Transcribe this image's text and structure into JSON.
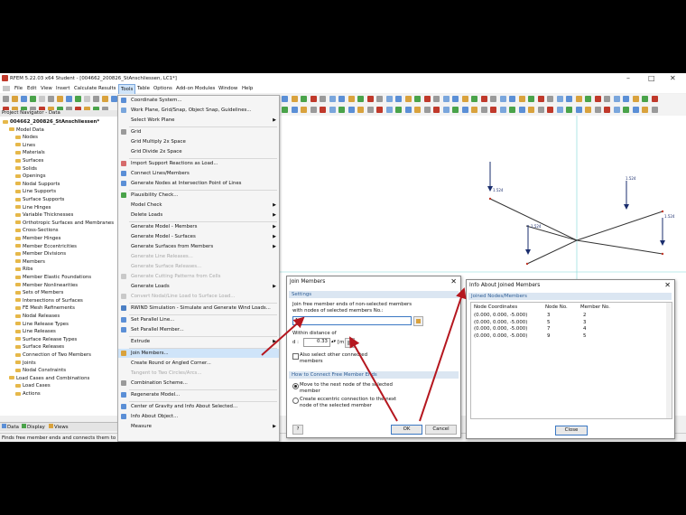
{
  "window": {
    "title": "RFEM 5.22.03 x64 Student - [004662_200826_StAnschliessen, LC1*]"
  },
  "menubar": [
    "File",
    "Edit",
    "View",
    "Insert",
    "Calculate",
    "Results",
    "Tools",
    "Table",
    "Options",
    "Add-on Modules",
    "Window",
    "Help"
  ],
  "navigator": {
    "title": "Project Navigator - Data",
    "items": [
      {
        "label": "004662_200826_StAnschliessen*",
        "indent": 0
      },
      {
        "label": "Model Data",
        "indent": 1
      },
      {
        "label": "Nodes",
        "indent": 2
      },
      {
        "label": "Lines",
        "indent": 2
      },
      {
        "label": "Materials",
        "indent": 2
      },
      {
        "label": "Surfaces",
        "indent": 2
      },
      {
        "label": "Solids",
        "indent": 2
      },
      {
        "label": "Openings",
        "indent": 2
      },
      {
        "label": "Nodal Supports",
        "indent": 2
      },
      {
        "label": "Line Supports",
        "indent": 2
      },
      {
        "label": "Surface Supports",
        "indent": 2
      },
      {
        "label": "Line Hinges",
        "indent": 2
      },
      {
        "label": "Variable Thicknesses",
        "indent": 2
      },
      {
        "label": "Orthotropic Surfaces and Membranes",
        "indent": 2
      },
      {
        "label": "Cross-Sections",
        "indent": 2
      },
      {
        "label": "Member Hinges",
        "indent": 2
      },
      {
        "label": "Member Eccentricities",
        "indent": 2
      },
      {
        "label": "Member Divisions",
        "indent": 2
      },
      {
        "label": "Members",
        "indent": 2
      },
      {
        "label": "Ribs",
        "indent": 2
      },
      {
        "label": "Member Elastic Foundations",
        "indent": 2
      },
      {
        "label": "Member Nonlinearities",
        "indent": 2
      },
      {
        "label": "Sets of Members",
        "indent": 2
      },
      {
        "label": "Intersections of Surfaces",
        "indent": 2
      },
      {
        "label": "FE Mesh Refinements",
        "indent": 2
      },
      {
        "label": "Nodal Releases",
        "indent": 2
      },
      {
        "label": "Line Release Types",
        "indent": 2
      },
      {
        "label": "Line Releases",
        "indent": 2
      },
      {
        "label": "Surface Release Types",
        "indent": 2
      },
      {
        "label": "Surface Releases",
        "indent": 2
      },
      {
        "label": "Connection of Two Members",
        "indent": 2
      },
      {
        "label": "Joints",
        "indent": 2
      },
      {
        "label": "Nodal Constraints",
        "indent": 2
      },
      {
        "label": "Load Cases and Combinations",
        "indent": 1
      },
      {
        "label": "Load Cases",
        "indent": 2
      },
      {
        "label": "Actions",
        "indent": 2
      }
    ],
    "tabs": [
      "Data",
      "Display",
      "Views"
    ]
  },
  "tools_menu": [
    {
      "label": "Coordinate System...",
      "disabled": false,
      "sub": false,
      "icon": "#5b8fd6",
      "sep": false
    },
    {
      "label": "Work Plane, Grid/Snap, Object Snap, Guidelines...",
      "disabled": false,
      "sub": false,
      "icon": "#7aa6dc",
      "sep": false
    },
    {
      "label": "Select Work Plane",
      "disabled": false,
      "sub": true,
      "icon": "",
      "sep": false
    },
    {
      "label": "Grid",
      "disabled": false,
      "sub": false,
      "icon": "#9a9a9a",
      "sep": true
    },
    {
      "label": "Grid Multiply 2x Space",
      "disabled": false,
      "sub": false,
      "icon": "",
      "sep": false
    },
    {
      "label": "Grid Divide 2x Space",
      "disabled": false,
      "sub": false,
      "icon": "",
      "sep": false
    },
    {
      "label": "Import Support Reactions as Load...",
      "disabled": false,
      "sub": false,
      "icon": "#d66b6b",
      "sep": true
    },
    {
      "label": "Connect Lines/Members",
      "disabled": false,
      "sub": false,
      "icon": "#5b8fd6",
      "sep": false
    },
    {
      "label": "Generate Nodes at Intersection Point of Lines",
      "disabled": false,
      "sub": false,
      "icon": "#5b8fd6",
      "sep": false
    },
    {
      "label": "Plausibility Check...",
      "disabled": false,
      "sub": false,
      "icon": "#4aa34a",
      "sep": true
    },
    {
      "label": "Model Check",
      "disabled": false,
      "sub": true,
      "icon": "",
      "sep": false
    },
    {
      "label": "Delete Loads",
      "disabled": false,
      "sub": true,
      "icon": "",
      "sep": false
    },
    {
      "label": "Generate Model - Members",
      "disabled": false,
      "sub": true,
      "icon": "",
      "sep": true
    },
    {
      "label": "Generate Model - Surfaces",
      "disabled": false,
      "sub": true,
      "icon": "",
      "sep": false
    },
    {
      "label": "Generate Surfaces from Members",
      "disabled": false,
      "sub": true,
      "icon": "",
      "sep": false
    },
    {
      "label": "Generate Line Releases...",
      "disabled": true,
      "sub": false,
      "icon": "",
      "sep": false
    },
    {
      "label": "Generate Surface Releases...",
      "disabled": true,
      "sub": false,
      "icon": "",
      "sep": false
    },
    {
      "label": "Generate Cutting Patterns from Cells",
      "disabled": true,
      "sub": false,
      "icon": "#c9c9c9",
      "sep": false
    },
    {
      "label": "Generate Loads",
      "disabled": false,
      "sub": true,
      "icon": "",
      "sep": false
    },
    {
      "label": "Convert Nodal/Line Load to Surface Load...",
      "disabled": true,
      "sub": false,
      "icon": "#c9c9c9",
      "sep": false
    },
    {
      "label": "RWIND Simulation - Simulate and Generate Wind Loads...",
      "disabled": false,
      "sub": false,
      "icon": "#4b7fc4",
      "sep": true
    },
    {
      "label": "Set Parallel Line...",
      "disabled": false,
      "sub": false,
      "icon": "#5b8fd6",
      "sep": true
    },
    {
      "label": "Set Parallel Member...",
      "disabled": false,
      "sub": false,
      "icon": "#5b8fd6",
      "sep": false
    },
    {
      "label": "Extrude",
      "disabled": false,
      "sub": true,
      "icon": "",
      "sep": true
    },
    {
      "label": "Join Members...",
      "disabled": false,
      "sub": false,
      "icon": "#d9a23d",
      "sep": true,
      "highlight": true
    },
    {
      "label": "Create Round or Angled Corner...",
      "disabled": false,
      "sub": false,
      "icon": "",
      "sep": false
    },
    {
      "label": "Tangent to Two Circles/Arcs...",
      "disabled": true,
      "sub": false,
      "icon": "",
      "sep": false
    },
    {
      "label": "Combination Scheme...",
      "disabled": false,
      "sub": false,
      "icon": "#9a9a9a",
      "sep": false
    },
    {
      "label": "Regenerate Model...",
      "disabled": false,
      "sub": false,
      "icon": "#5b8fd6",
      "sep": true
    },
    {
      "label": "Center of Gravity and Info About Selected...",
      "disabled": false,
      "sub": false,
      "icon": "#5b8fd6",
      "sep": true
    },
    {
      "label": "Info About Object...",
      "disabled": false,
      "sub": false,
      "icon": "#5b8fd6",
      "sep": false
    },
    {
      "label": "Measure",
      "disabled": false,
      "sub": true,
      "icon": "",
      "sep": false
    }
  ],
  "join_dialog": {
    "title": "Join Members",
    "settings_header": "Settings",
    "desc": "Join free member ends of non-selected members with nodes of selected members No.:",
    "member_no": "1",
    "within_label": "Within distance of",
    "d_label": "d :",
    "d_value": "0.33",
    "d_unit": "[m]",
    "also_select": "Also select other connected members",
    "how_header": "How to Connect Free Member Ends",
    "option1": "Move to the next node of the selected member",
    "option2": "Create eccentric connection to the next node of the selected member",
    "ok": "OK",
    "cancel": "Cancel"
  },
  "info_dialog": {
    "title": "Info About Joined Members",
    "section": "Joined Nodes/Members",
    "columns": [
      "Node Coordinates",
      "Node No.",
      "Member No."
    ],
    "rows": [
      [
        "(0.000, 0.000, -5.000)",
        "3",
        "2"
      ],
      [
        "(0.000, 0.000, -5.000)",
        "5",
        "3"
      ],
      [
        "(0.000, 0.000, -5.000)",
        "7",
        "4"
      ],
      [
        "(0.000, 0.000, -5.000)",
        "9",
        "5"
      ]
    ],
    "close": "Close"
  },
  "loads": [
    "1.524",
    "1.524",
    "1.524",
    "1.524"
  ],
  "status": "Finds free member ends and connects them to other me",
  "colors": {
    "arrow": "#b5171f",
    "accent": "#2d5d95",
    "highlight": "#cfe4f9"
  }
}
